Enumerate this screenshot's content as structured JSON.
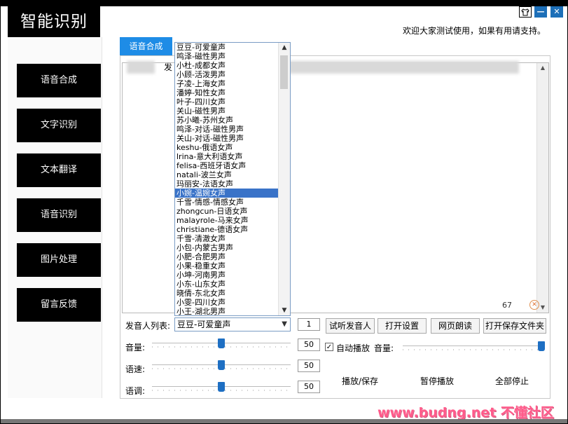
{
  "app": {
    "title": "智能识别",
    "welcome": "欢迎大家测试使用，如果有用请支持。"
  },
  "window_controls": {
    "skin_icon": "shirt-icon",
    "minimize": "—",
    "close": "✕"
  },
  "nav": {
    "items": [
      {
        "label": "语音合成"
      },
      {
        "label": "文字识别"
      },
      {
        "label": "文本翻译"
      },
      {
        "label": "语音识别"
      },
      {
        "label": "图片处理"
      },
      {
        "label": "留言反馈"
      }
    ]
  },
  "tab": {
    "label": "语音合成"
  },
  "textarea": {
    "label_fragment": "发",
    "char_count": "67",
    "clear_icon": "✕"
  },
  "voice_dropdown": {
    "selected_index": 16,
    "options": [
      "豆豆-可爱童声",
      "鸣泽-磁性男声",
      "小杜-成都女声",
      "小顾-活泼男声",
      "子凌-上海女声",
      "潘婷-知性女声",
      "叶子-四川女声",
      "关山-磁性男声",
      "苏小曦-苏州女声",
      "鸣泽-对话-磁性男声",
      "关山-对话-磁性男声",
      "keshu-俄语女声",
      "lrina-意大利语女声",
      "felisa-西班牙语女声",
      "natali-波兰女声",
      "玛丽安-法语女声",
      "小婉-温婉女声",
      "千雪-情感-情感女声",
      "zhongcun-日语女声",
      "malayrole-马来女声",
      "christiane-德语女声",
      "千雪-清澈女声",
      "小包-内蒙古男声",
      "小肥-合肥男声",
      "小果-稳重女声",
      "小坤-河南男声",
      "小东-山东女声",
      "晓倩-东北女声",
      "小雯-四川女声",
      "小王-湖北男声"
    ]
  },
  "controls": {
    "speaker_label": "发音人列表:",
    "speaker_selected": "豆豆-可爱童声",
    "speaker_count": "1",
    "buttons": [
      "试听发音人",
      "打开设置",
      "网页朗读",
      "打开保存文件夹"
    ],
    "volume": {
      "label": "音量:",
      "value": "50",
      "level": 0.5
    },
    "speed": {
      "label": "语速:",
      "value": "50",
      "level": 0.5
    },
    "pitch": {
      "label": "语调:",
      "value": "50",
      "level": 0.5
    },
    "autoplay": {
      "label": "自动播放",
      "checked": true
    },
    "playback_volume": {
      "label": "音量:",
      "level": 1.0
    },
    "actions": [
      "播放/保存",
      "暂停播放",
      "全部停止"
    ]
  },
  "watermark": "www.budng.net 不懂社区"
}
